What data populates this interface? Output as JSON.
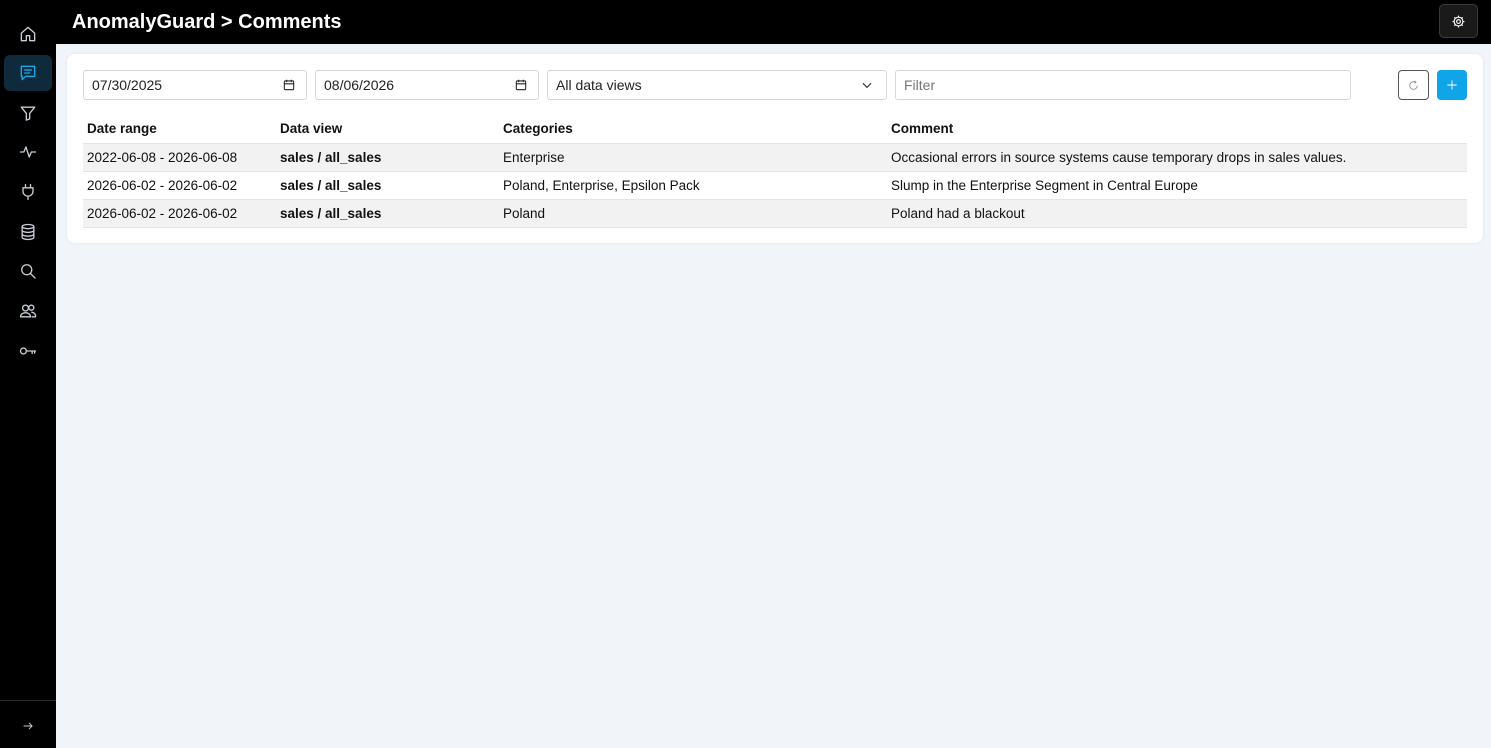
{
  "app": {
    "title": "AnomalyGuard > Comments"
  },
  "sidebar": {
    "items": [
      {
        "name": "home",
        "icon": "home-icon"
      },
      {
        "name": "comments",
        "icon": "comment-icon",
        "active": true
      },
      {
        "name": "filters",
        "icon": "filter-icon"
      },
      {
        "name": "activity",
        "icon": "pulse-icon"
      },
      {
        "name": "connections",
        "icon": "plug-icon"
      },
      {
        "name": "database",
        "icon": "database-icon"
      },
      {
        "name": "search",
        "icon": "search-icon"
      },
      {
        "name": "users",
        "icon": "users-icon"
      },
      {
        "name": "keys",
        "icon": "key-icon"
      }
    ],
    "expand_icon": "arrow-right-icon"
  },
  "toolbar": {
    "date_from": "07/30/2025",
    "date_to": "08/06/2026",
    "data_view_selected": "All data views",
    "filter_placeholder": "Filter"
  },
  "table": {
    "headers": [
      "Date range",
      "Data view",
      "Categories",
      "Comment"
    ],
    "rows": [
      {
        "date_range": "2022-06-08 - 2026-06-08",
        "data_view": "sales / all_sales",
        "categories": "Enterprise",
        "comment": "Occasional errors in source systems cause temporary drops in sales values."
      },
      {
        "date_range": "2026-06-02 - 2026-06-02",
        "data_view": "sales / all_sales",
        "categories": "Poland, Enterprise, Epsilon Pack",
        "comment": "Slump in the Enterprise Segment in Central Europe"
      },
      {
        "date_range": "2026-06-02 - 2026-06-02",
        "data_view": "sales / all_sales",
        "categories": "Poland",
        "comment": "Poland had a blackout"
      }
    ]
  },
  "colors": {
    "accent": "#10a4e8",
    "sidebar_bg": "#000000",
    "page_bg": "#f1f4f9"
  }
}
